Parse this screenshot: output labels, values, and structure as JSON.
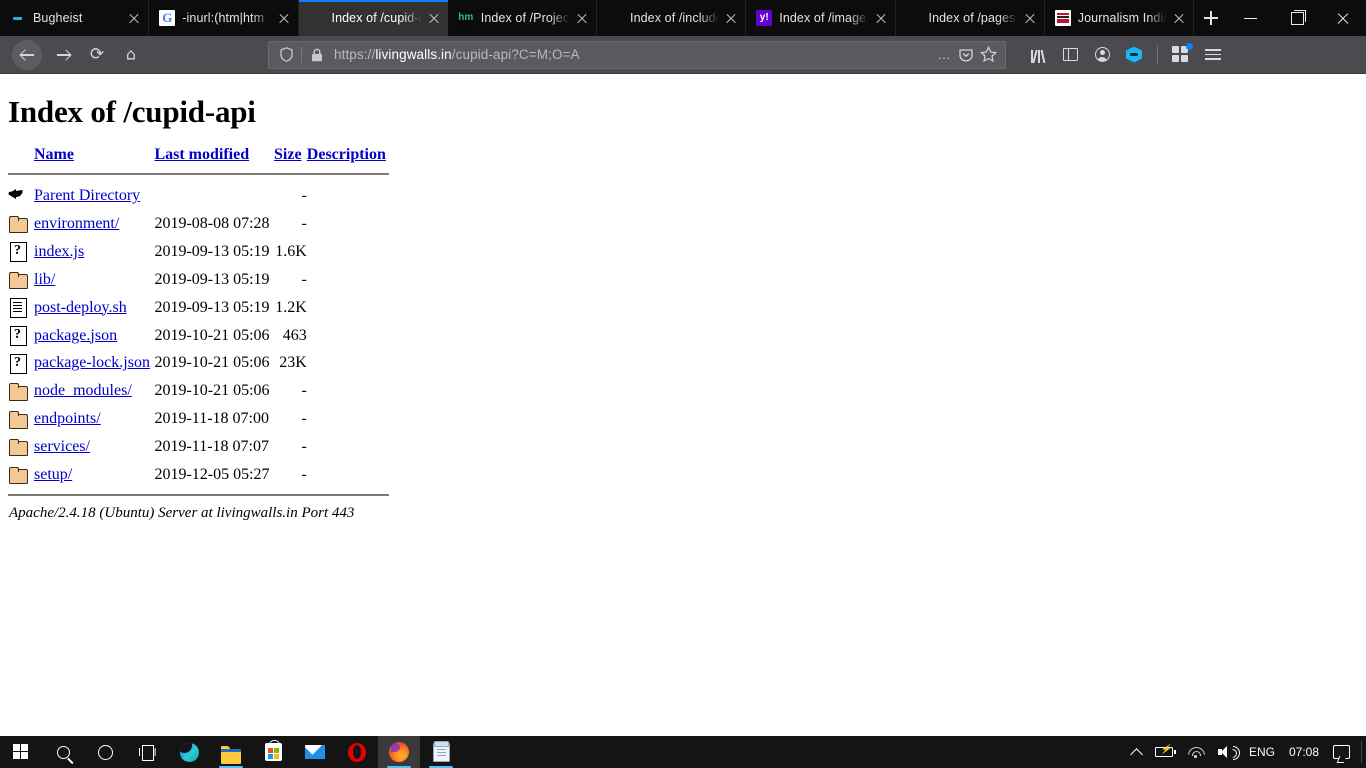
{
  "browser": {
    "tabs": [
      {
        "title": "Bugheist",
        "favicon": "dash-favicon",
        "active": false
      },
      {
        "title": "-inurl:(htm|htm",
        "favicon": "google-favicon",
        "active": false
      },
      {
        "title": "Index of /cupid-api",
        "favicon": "none-favicon",
        "active": true
      },
      {
        "title": "Index of /Projec",
        "favicon": "hm-favicon",
        "active": false
      },
      {
        "title": "Index of /include",
        "favicon": "none-favicon",
        "active": false
      },
      {
        "title": "Index of /image",
        "favicon": "yahoo-favicon",
        "active": false
      },
      {
        "title": "Index of /pages",
        "favicon": "none-favicon",
        "active": false
      },
      {
        "title": "Journalism India",
        "favicon": "india-favicon",
        "active": false
      }
    ],
    "new_tab_label": "+",
    "window_controls": {
      "minimize": "–",
      "maximize": "❐",
      "close": "✕"
    },
    "nav": {
      "back": "back-arrow",
      "forward": "forward-arrow",
      "reload": "⟳",
      "home": "⌂"
    },
    "url": {
      "scheme": "https://",
      "host": "livingwalls.in",
      "path": "/cupid-api?C=M;O=A",
      "full": "https://livingwalls.in/cupid-api?C=M;O=A",
      "shield_icon": "🛡",
      "lock_icon": "🔒",
      "page_actions": "…",
      "pocket_icon": "pocket",
      "bookmark_icon": "☆"
    },
    "toolbar_right": {
      "library": "library-icon",
      "sidebar": "sidebar-icon",
      "account": "account-icon",
      "pocket": "pocket-extension-icon",
      "extensions": "extensions-icon",
      "menu": "hamburger-menu-icon"
    }
  },
  "page": {
    "title": "Index of /cupid-api",
    "columns": [
      {
        "label": "Name"
      },
      {
        "label": "Last modified"
      },
      {
        "label": "Size"
      },
      {
        "label": "Description"
      }
    ],
    "rows": [
      {
        "icon": "back-icon",
        "name": "Parent Directory",
        "modified": "",
        "size": "-",
        "description": ""
      },
      {
        "icon": "folder-icon",
        "name": "environment/",
        "modified": "2019-08-08 07:28",
        "size": "-",
        "description": ""
      },
      {
        "icon": "unknown-icon",
        "name": "index.js",
        "modified": "2019-09-13 05:19",
        "size": "1.6K",
        "description": ""
      },
      {
        "icon": "folder-icon",
        "name": "lib/",
        "modified": "2019-09-13 05:19",
        "size": "-",
        "description": ""
      },
      {
        "icon": "text-icon",
        "name": "post-deploy.sh",
        "modified": "2019-09-13 05:19",
        "size": "1.2K",
        "description": ""
      },
      {
        "icon": "unknown-icon",
        "name": "package.json",
        "modified": "2019-10-21 05:06",
        "size": "463",
        "description": ""
      },
      {
        "icon": "unknown-icon",
        "name": "package-lock.json",
        "modified": "2019-10-21 05:06",
        "size": "23K",
        "description": ""
      },
      {
        "icon": "folder-icon",
        "name": "node_modules/",
        "modified": "2019-10-21 05:06",
        "size": "-",
        "description": ""
      },
      {
        "icon": "folder-icon",
        "name": "endpoints/",
        "modified": "2019-11-18 07:00",
        "size": "-",
        "description": ""
      },
      {
        "icon": "folder-icon",
        "name": "services/",
        "modified": "2019-11-18 07:07",
        "size": "-",
        "description": ""
      },
      {
        "icon": "folder-icon",
        "name": "setup/",
        "modified": "2019-12-05 05:27",
        "size": "-",
        "description": ""
      }
    ],
    "footer": "Apache/2.4.18 (Ubuntu) Server at livingwalls.in Port 443"
  },
  "taskbar": {
    "start": "windows-start-icon",
    "search": "search-icon",
    "cortana": "cortana-icon",
    "task_view": "task-view-icon",
    "apps": [
      {
        "name": "edge-icon",
        "running": false,
        "active": false
      },
      {
        "name": "explorer-icon",
        "running": true,
        "active": false
      },
      {
        "name": "store-icon",
        "running": false,
        "active": false
      },
      {
        "name": "mail-icon",
        "running": false,
        "active": false
      },
      {
        "name": "opera-icon",
        "running": false,
        "active": false
      },
      {
        "name": "firefox-icon",
        "running": true,
        "active": true
      },
      {
        "name": "notepad-icon",
        "running": true,
        "active": false
      }
    ],
    "tray": {
      "show_hidden": "chevron-up-icon",
      "battery": "battery-charging-icon",
      "network": "wifi-icon",
      "volume": "speaker-icon",
      "language": "ENG",
      "clock": "07:08",
      "action_center": "action-center-icon"
    }
  }
}
